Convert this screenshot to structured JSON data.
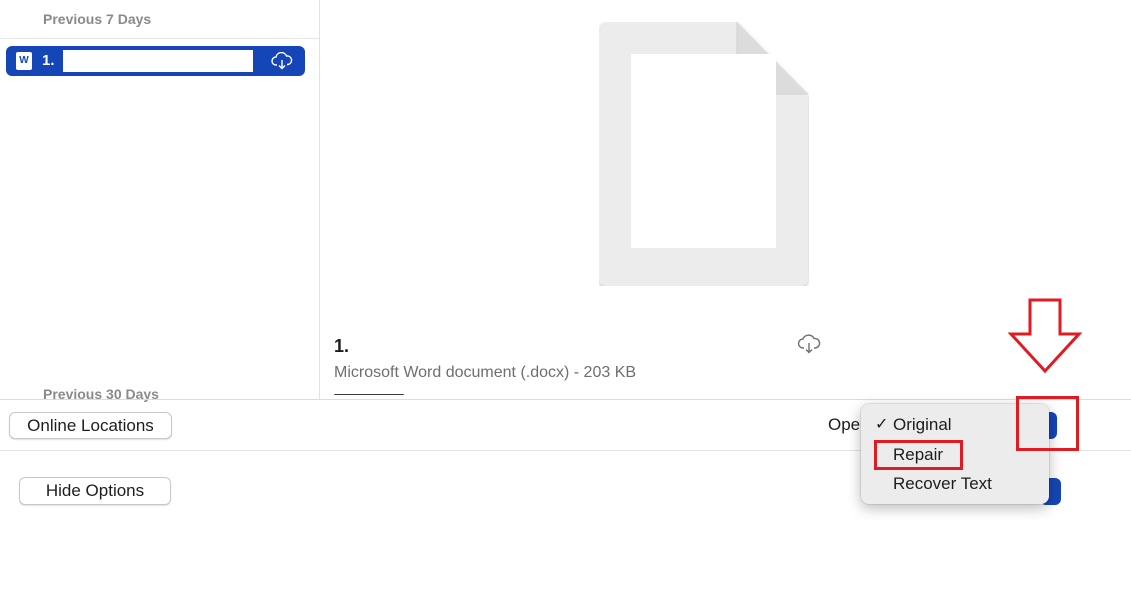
{
  "sidebar": {
    "section_recent": "Previous 7 Days",
    "section_older": "Previous 30 Days",
    "recent_item": {
      "label": "1.",
      "icon": "word-doc-icon",
      "action_icon": "cloud-download-icon"
    }
  },
  "preview": {
    "file_title": "1.",
    "file_meta": "Microsoft Word document (.docx) - 203 KB",
    "cloud_icon": "cloud-download-icon"
  },
  "footer": {
    "online_locations_label": "Online Locations",
    "hide_options_label": "Hide Options",
    "open_label_partial": "Ope"
  },
  "open_menu": {
    "items": [
      {
        "label": "Original",
        "checked": true
      },
      {
        "label": "Repair",
        "checked": false
      },
      {
        "label": "Recover Text",
        "checked": false
      }
    ],
    "check_glyph": "✓"
  },
  "annotations": {
    "color": "#e11b22",
    "arrow": "down-arrow-outline",
    "highlighted_item": "Repair"
  },
  "colors": {
    "accent": "#1546b7"
  }
}
